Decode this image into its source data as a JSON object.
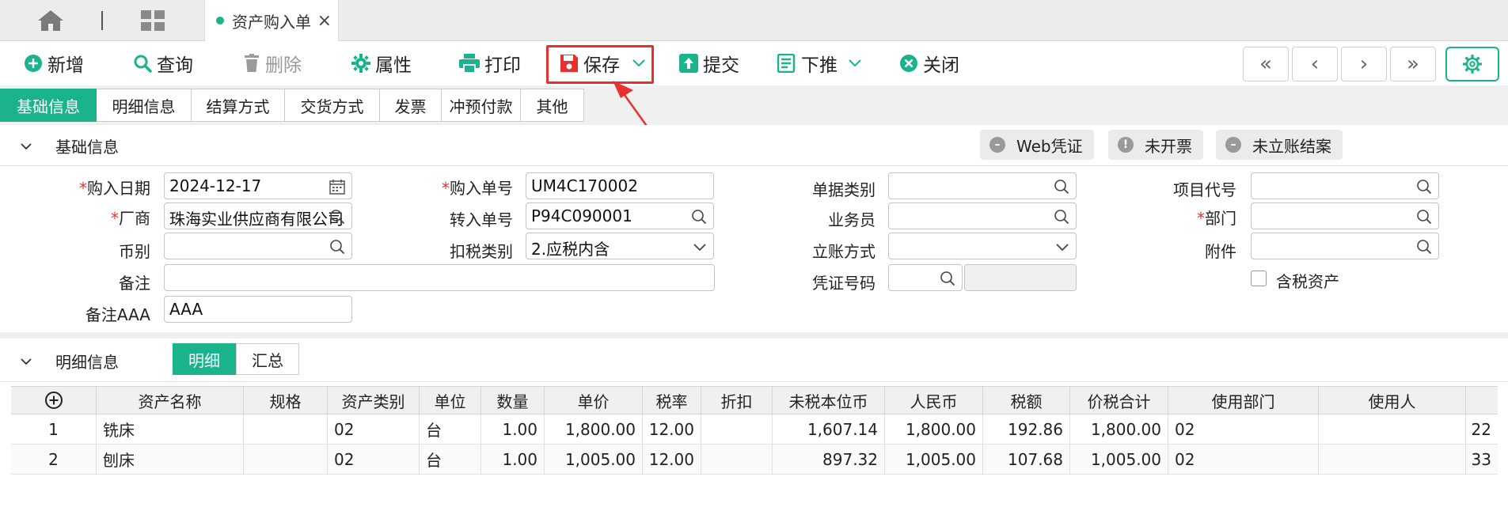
{
  "tabbar": {
    "tab_title": "资产购入单",
    "close": "×"
  },
  "toolbar": {
    "add": "新增",
    "query": "查询",
    "delete": "删除",
    "props": "属性",
    "print": "打印",
    "save": "保存",
    "submit": "提交",
    "push": "下推",
    "close": "关闭"
  },
  "nav": {
    "first": "«",
    "prev": "‹",
    "next": "›",
    "last": "»"
  },
  "subtabs": [
    "基础信息",
    "明细信息",
    "结算方式",
    "交货方式",
    "发票",
    "冲预付款",
    "其他"
  ],
  "basic": {
    "title": "基础信息",
    "badges": [
      "Web凭证",
      "未开票",
      "未立账结案"
    ],
    "fields": {
      "purchase_date": {
        "label": "购入日期",
        "value": "2024-12-17"
      },
      "purchase_no": {
        "label": "购入单号",
        "value": "UM4C170002"
      },
      "doc_type": {
        "label": "单据类别",
        "value": ""
      },
      "project_code": {
        "label": "项目代号",
        "value": ""
      },
      "vendor": {
        "label": "厂商",
        "value": "珠海实业供应商有限公司"
      },
      "transfer_no": {
        "label": "转入单号",
        "value": "P94C090001"
      },
      "salesman": {
        "label": "业务员",
        "value": ""
      },
      "dept": {
        "label": "部门",
        "value": ""
      },
      "currency": {
        "label": "币别",
        "value": ""
      },
      "tax_type": {
        "label": "扣税类别",
        "value": "2.应税内含"
      },
      "account_method": {
        "label": "立账方式",
        "value": ""
      },
      "attachment": {
        "label": "附件",
        "value": ""
      },
      "remark": {
        "label": "备注",
        "value": ""
      },
      "voucher_no": {
        "label": "凭证号码",
        "value": ""
      },
      "tax_asset": {
        "label": "含税资产"
      },
      "remark_aaa": {
        "label": "备注AAA",
        "value": "AAA"
      }
    }
  },
  "detail": {
    "title": "明细信息",
    "seg": [
      "明细",
      "汇总"
    ],
    "columns": [
      "资产名称",
      "规格",
      "资产类别",
      "单位",
      "数量",
      "单价",
      "税率",
      "折扣",
      "未税本位币",
      "人民币",
      "税额",
      "价税合计",
      "使用部门",
      "使用人"
    ],
    "rows": [
      [
        "1",
        "铣床",
        "",
        "02",
        "台",
        "1.00",
        "1,800.00",
        "12.00",
        "",
        "1,607.14",
        "1,800.00",
        "192.86",
        "1,800.00",
        "02",
        "",
        "22"
      ],
      [
        "2",
        "刨床",
        "",
        "02",
        "台",
        "1.00",
        "1,005.00",
        "12.00",
        "",
        "897.32",
        "1,005.00",
        "107.68",
        "1,005.00",
        "02",
        "",
        "33"
      ]
    ]
  },
  "colors": {
    "accent": "#1ab38c",
    "highlight": "#e8302f",
    "required": "#e8302f"
  }
}
